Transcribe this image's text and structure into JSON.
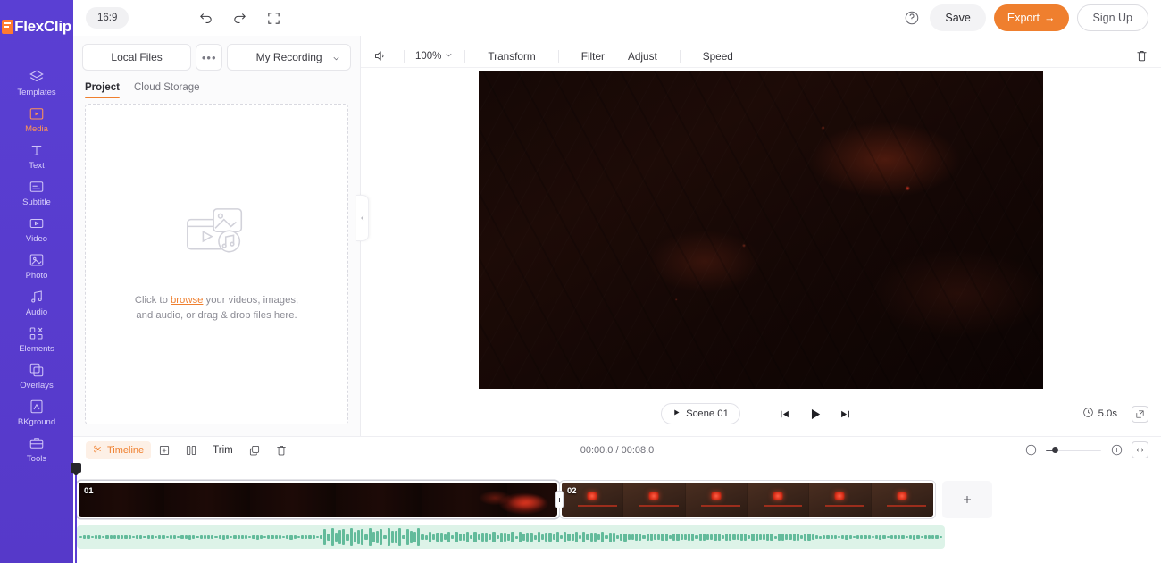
{
  "app": {
    "name": "FlexClip"
  },
  "sidebar": {
    "items": [
      {
        "label": "Templates",
        "icon": "layers-icon",
        "active": false
      },
      {
        "label": "Media",
        "icon": "media-folder-icon",
        "active": true
      },
      {
        "label": "Text",
        "icon": "text-icon",
        "active": false
      },
      {
        "label": "Subtitle",
        "icon": "subtitle-icon",
        "active": false
      },
      {
        "label": "Video",
        "icon": "video-icon",
        "active": false
      },
      {
        "label": "Photo",
        "icon": "photo-icon",
        "active": false
      },
      {
        "label": "Audio",
        "icon": "audio-note-icon",
        "active": false
      },
      {
        "label": "Elements",
        "icon": "elements-icon",
        "active": false
      },
      {
        "label": "Overlays",
        "icon": "overlays-icon",
        "active": false
      },
      {
        "label": "BKground",
        "icon": "background-icon",
        "active": false
      },
      {
        "label": "Tools",
        "icon": "tools-icon",
        "active": false
      }
    ]
  },
  "topbar": {
    "ratio": "16:9",
    "undo_icon": "undo-icon",
    "redo_icon": "redo-icon",
    "fullscreen_icon": "expand-icon",
    "help_icon": "question-circle-icon",
    "save_label": "Save",
    "export_label": "Export",
    "export_arrow": "→",
    "signup_label": "Sign Up"
  },
  "media_panel": {
    "local_files_label": "Local Files",
    "more_label": "•••",
    "recording_label": "My Recording",
    "tabs": [
      {
        "label": "Project",
        "active": true
      },
      {
        "label": "Cloud Storage",
        "active": false
      }
    ],
    "dropzone": {
      "icon": "upload-media-icon",
      "text_before": "Click to ",
      "link": "browse",
      "text_after": " your videos, images, and audio, or drag & drop files here."
    },
    "collapse_icon": "chevron-left-icon"
  },
  "preview": {
    "toolbar": {
      "volume_icon": "speaker-icon",
      "zoom_value": "100%",
      "items": [
        "Transform",
        "Filter",
        "Adjust",
        "Speed"
      ],
      "delete_icon": "trash-icon"
    },
    "controls": {
      "scene_label": "Scene 01",
      "scene_icon": "play-small-icon",
      "prev_icon": "skip-back-icon",
      "play_icon": "play-icon",
      "next_icon": "skip-forward-icon",
      "duration": "5.0s",
      "clock_icon": "clock-icon",
      "fullscreen_icon": "fit-screen-icon"
    }
  },
  "timeline": {
    "badge_label": "Timeline",
    "badge_icon": "scissors-icon",
    "add_icon": "add-box-icon",
    "split_icon": "split-icon",
    "trim_label": "Trim",
    "duplicate_icon": "duplicate-icon",
    "delete_icon": "trash-icon",
    "timecode": "00:00.0 / 00:08.0",
    "zoom_out_icon": "minus-circle-icon",
    "zoom_in_icon": "plus-circle-icon",
    "fit_icon": "fit-width-icon",
    "zoom_level": 12,
    "clips": [
      {
        "number": "01",
        "selected": true
      },
      {
        "number": "02",
        "selected": false
      }
    ],
    "add_clip_icon": "plus-icon"
  },
  "colors": {
    "brand_purple": "#5b3fd4",
    "accent_orange": "#ef7f2e",
    "audio_track": "#ddf3e8",
    "waveform": "#3aa882"
  }
}
